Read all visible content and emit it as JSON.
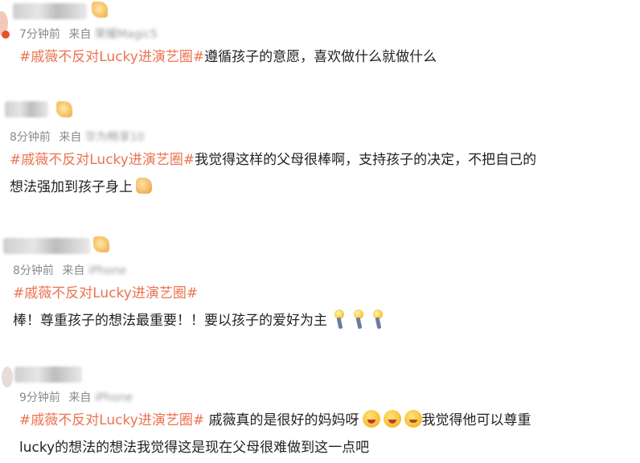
{
  "posts": [
    {
      "meta": {
        "time": "7分钟前",
        "source_prefix": "来自",
        "source": "荣耀Magic5"
      },
      "tag": "#戚薇不反对Lucky进演艺圈#",
      "text_lines": [
        "遵循孩子的意愿，喜欢做什么就做什么"
      ]
    },
    {
      "meta": {
        "time": "8分钟前",
        "source_prefix": "来自",
        "source": "华为畅享10"
      },
      "tag": "#戚薇不反对Lucky进演艺圈#",
      "text_lines": [
        "我觉得这样的父母很棒啊，支持孩子的决定，不把自己的",
        "想法强加到孩子身上"
      ],
      "emoji": "thumbs-up"
    },
    {
      "meta": {
        "time": "8分钟前",
        "source_prefix": "来自",
        "source": "iPhone"
      },
      "tag": "#戚薇不反对Lucky进演艺圈#",
      "text_lines": [
        "棒！尊重孩子的想法最重要！！要以孩子的爱好为主"
      ],
      "emoji": "torch"
    },
    {
      "meta": {
        "time": "9分钟前",
        "source_prefix": "来自",
        "source": "iPhone"
      },
      "tag": "#戚薇不反对Lucky进演艺圈#",
      "text_lines": [
        " 戚薇真的是很好的妈妈呀",
        "我觉得他可以尊重",
        "lucky的想法的想法我觉得这是现在父母很难做到这一点吧"
      ],
      "emoji": "grinning-face"
    }
  ]
}
